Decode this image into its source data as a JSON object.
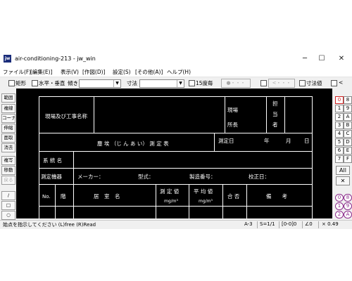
{
  "window": {
    "title": "air-conditioning-213 - jw_win",
    "icon_label": "jw"
  },
  "window_buttons": {
    "minimize": "─",
    "maximize": "☐",
    "close": "✕"
  },
  "menu": [
    "ファイル(F)",
    "[編集(E)]",
    "表示(V)",
    "[作図(D)]",
    "設定(S)",
    "[その他(A)]",
    "ヘルプ(H)"
  ],
  "toolbar": {
    "rect_label": "矩形",
    "hv_label": "水平・垂直",
    "tilt_label": "傾き",
    "dim_label": "寸法",
    "deg15_label": "15度毎",
    "btn_disabled1": "●・・・",
    "btn_disabled2": "<・・・",
    "dimval_label": "寸法値",
    "last_label": "<"
  },
  "left_panel": [
    "範囲",
    "複線",
    "コーナー",
    "伸縮",
    "面取",
    "消去",
    "複写",
    "移動",
    "戻る",
    "/",
    "□",
    "○"
  ],
  "right_panel": {
    "layers_left": [
      "0",
      "1",
      "2",
      "3",
      "4",
      "5",
      "6",
      "7"
    ],
    "layers_right": [
      "8",
      "9",
      "A",
      "B",
      "C",
      "D",
      "E",
      "F"
    ],
    "all_label": "All",
    "cross_label": "✕",
    "circ_left": [
      "0",
      "1",
      "2"
    ],
    "circ_right": [
      "8",
      "9",
      "A"
    ]
  },
  "form": {
    "project_name": "現場及び工事名称",
    "site": "現場",
    "director": "所長",
    "charge": [
      "担",
      "当",
      "者"
    ],
    "title": "塵 埃 （じ ん あ い） 測 定 表",
    "date_label": "測定日",
    "year": "年",
    "month": "月",
    "day": "日",
    "system_name": "系 統 名",
    "instrument": "測定機器",
    "maker": "メーカー：",
    "model": "型式：",
    "serial": "製造番号：",
    "calib": "校正日：",
    "col_no": "No.",
    "col_floor": "階",
    "col_room": "居　室　名",
    "col_measured": "測 定 値",
    "col_avg": "平 均 値",
    "unit": "mg/m³",
    "col_pass": "合 否",
    "col_note": "備　　考"
  },
  "status": {
    "message": "始点を指示してください (L)free (R)Read",
    "scale": "A-3",
    "ratio": "S=1/1",
    "layer": "[0-0]0",
    "angle": "∠0",
    "zoom": "× 0.49"
  }
}
